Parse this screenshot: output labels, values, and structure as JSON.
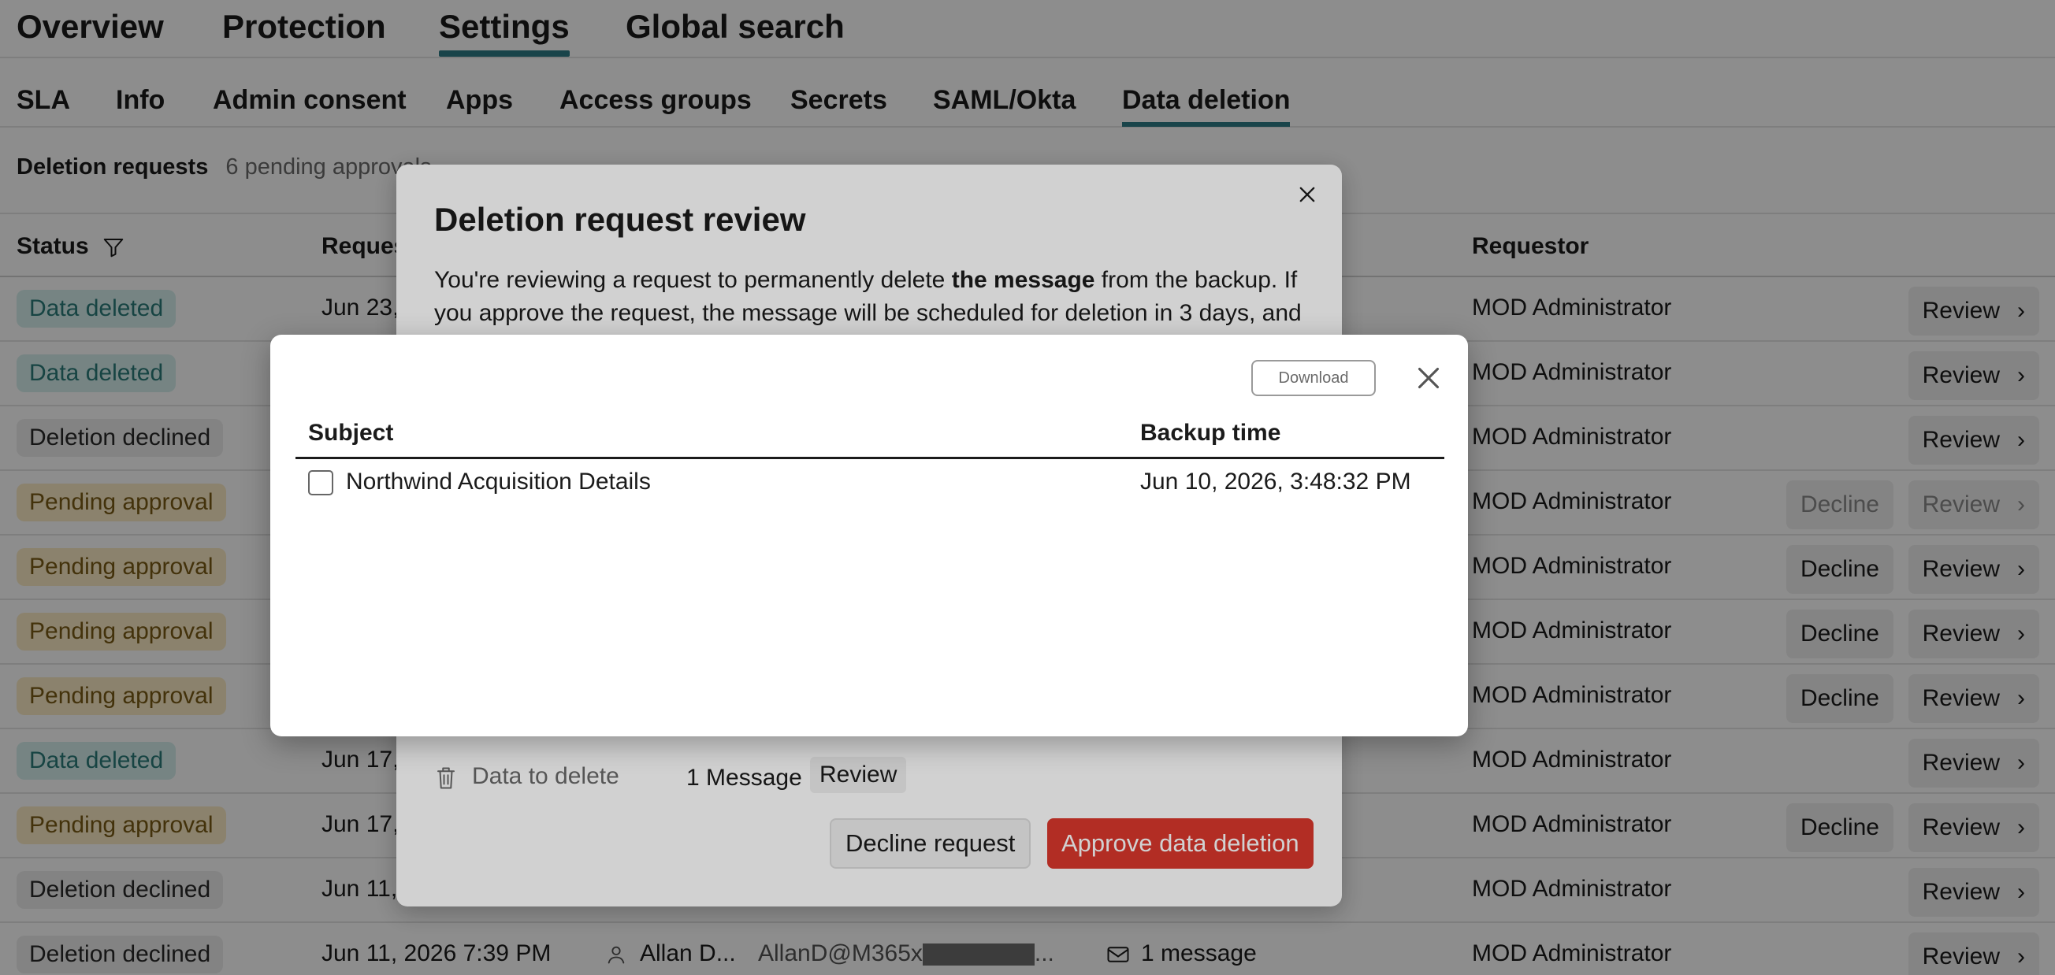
{
  "top_tabs": [
    {
      "label": "Overview"
    },
    {
      "label": "Protection"
    },
    {
      "label": "Settings",
      "active": true
    },
    {
      "label": "Global search"
    }
  ],
  "sub_tabs": [
    {
      "label": "SLA"
    },
    {
      "label": "Info"
    },
    {
      "label": "Admin consent"
    },
    {
      "label": "Apps"
    },
    {
      "label": "Access groups"
    },
    {
      "label": "Secrets"
    },
    {
      "label": "SAML/Okta"
    },
    {
      "label": "Data deletion",
      "active": true
    }
  ],
  "requests": {
    "label": "Deletion requests",
    "count": "6 pending approvals"
  },
  "table": {
    "headers": {
      "status": "Status",
      "requested": "Requested",
      "requestor": "Requestor"
    },
    "review_label": "Review",
    "decline_label": "Decline",
    "rows": [
      {
        "status": "Data deleted",
        "status_type": "deleted",
        "date": "Jun 23,",
        "requestor": "MOD Administrator",
        "decline": false
      },
      {
        "status": "Data deleted",
        "status_type": "deleted",
        "date": "",
        "requestor": "MOD Administrator",
        "decline": false
      },
      {
        "status": "Deletion declined",
        "status_type": "declined",
        "date": "",
        "requestor": "MOD Administrator",
        "decline": false
      },
      {
        "status": "Pending approval",
        "status_type": "pending",
        "date": "",
        "requestor": "MOD Administrator",
        "decline": true,
        "dimmed": true
      },
      {
        "status": "Pending approval",
        "status_type": "pending",
        "date": "",
        "requestor": "MOD Administrator",
        "decline": true
      },
      {
        "status": "Pending approval",
        "status_type": "pending",
        "date": "",
        "requestor": "MOD Administrator",
        "decline": true
      },
      {
        "status": "Pending approval",
        "status_type": "pending",
        "date": "",
        "requestor": "MOD Administrator",
        "decline": true
      },
      {
        "status": "Data deleted",
        "status_type": "deleted",
        "date": "Jun 17,",
        "requestor": "MOD Administrator",
        "decline": false
      },
      {
        "status": "Pending approval",
        "status_type": "pending",
        "date": "Jun 17,",
        "requestor": "MOD Administrator",
        "decline": true
      },
      {
        "status": "Deletion declined",
        "status_type": "declined",
        "date": "Jun 11,",
        "requestor": "MOD Administrator",
        "decline": false
      },
      {
        "status": "Deletion declined",
        "status_type": "declined",
        "date": "Jun 11, 2026 7:39 PM",
        "user": "Allan D...",
        "email": "AllanD@M365x",
        "email_suffix": "...",
        "item": "1 message",
        "requestor": "MOD Administrator",
        "decline": false
      }
    ]
  },
  "review_dialog": {
    "title": "Deletion request review",
    "desc_part1": "You're reviewing a request to permanently delete ",
    "desc_bold": "the message",
    "desc_part2": " from the backup. If you approve the request, the message will be scheduled for deletion in 3 days, and",
    "data_label": "Data to delete",
    "data_count": "1 Message",
    "data_review": "Review",
    "decline_button": "Decline request",
    "approve_button": "Approve data deletion",
    "approve_color": "#d9382c"
  },
  "message_modal": {
    "download_label": "Download",
    "headers": {
      "subject": "Subject",
      "backup_time": "Backup time"
    },
    "rows": [
      {
        "subject": "Northwind Acquisition Details",
        "backup_time": "Jun 10, 2026, 3:48:32 PM",
        "checked": false
      }
    ]
  },
  "colors": {
    "accent": "#2f7d86",
    "deleted_badge": "#d4eeec",
    "pending_badge": "#fbebc4",
    "declined_badge": "#ececec",
    "danger": "#d9382c"
  }
}
